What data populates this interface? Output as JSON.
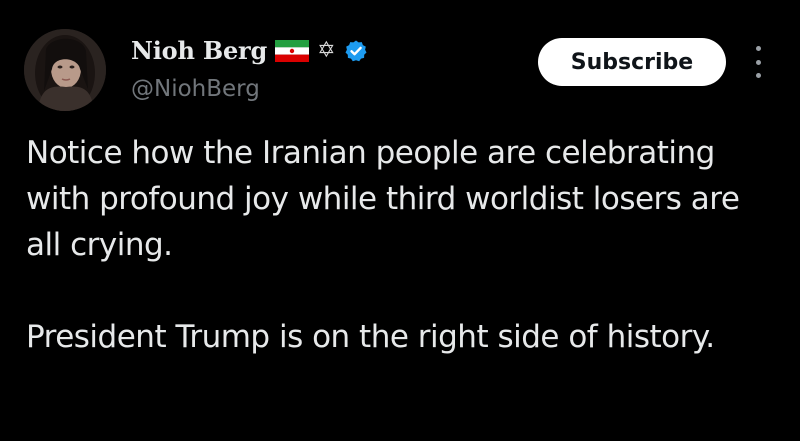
{
  "author": {
    "display_name": "Nioh Berg",
    "handle": "@NiohBerg",
    "icons": [
      "iran-flag-icon",
      "star-of-david-icon",
      "verified-badge-icon"
    ]
  },
  "actions": {
    "subscribe_label": "Subscribe",
    "more_icon": "more-vertical-icon"
  },
  "tweet": {
    "paragraphs": [
      "Notice how the Iranian people are celebrating with profound joy while third worldist losers are all crying.",
      "President Trump is on the right side of history."
    ]
  },
  "colors": {
    "background": "#000000",
    "text": "#e7e9ea",
    "secondary": "#71767b",
    "verified": "#1d9bf0",
    "button_bg": "#ffffff"
  }
}
